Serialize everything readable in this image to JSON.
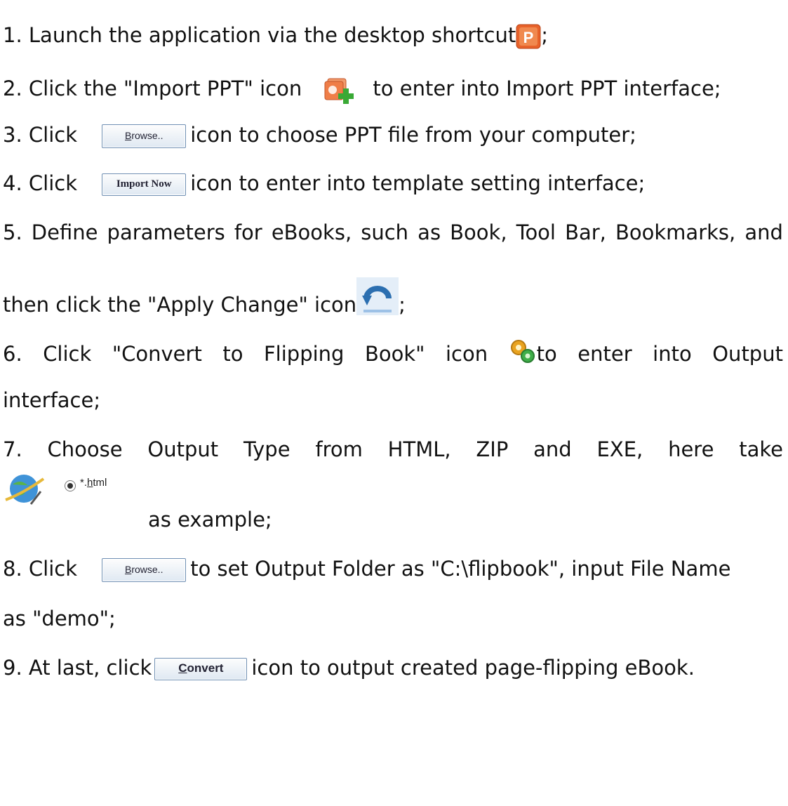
{
  "steps": {
    "s1": {
      "text": "1. Launch the application via the desktop shortcut",
      "after": ";",
      "icon": "powerpoint-shortcut-icon"
    },
    "s2": {
      "text": "2. Click the \"Import PPT\" icon",
      "after": "to enter into Import PPT interface;",
      "icon": "import-ppt-icon"
    },
    "s3": {
      "text": "3. Click",
      "button": "Browse..",
      "after": "icon to choose PPT file from your computer;"
    },
    "s4": {
      "text": "4. Click",
      "button": "Import Now",
      "after": "icon to enter into template setting interface;"
    },
    "s5": {
      "line1": [
        "5.",
        "Define",
        "parameters",
        "for",
        "eBooks,",
        "such",
        "as",
        "Book,",
        "Tool",
        "Bar,",
        "Bookmarks,",
        "and"
      ],
      "line2": "then click the \"Apply Change\" icon",
      "after": ";",
      "icon": "apply-change-icon"
    },
    "s6": {
      "line1": [
        "6.",
        "Click",
        "\"Convert",
        "to",
        "Flipping",
        "Book\"",
        "icon"
      ],
      "after_words": [
        "to",
        "enter",
        "into",
        "Output"
      ],
      "line2": "interface;",
      "icon": "gears-icon"
    },
    "s7": {
      "line1": [
        "7.",
        "Choose",
        "Output",
        "Type",
        "from",
        "HTML,",
        "ZIP",
        "and",
        "EXE,",
        "here",
        "take"
      ],
      "radio_label": "*.html",
      "line2": "as example;",
      "icon": "globe-html-icon"
    },
    "s8": {
      "text": "8. Click",
      "button": "Browse..",
      "after": "to set Output Folder as \"C:\\flipbook\", input File Name",
      "line2": "as \"demo\";"
    },
    "s9": {
      "text": "9. At last, click",
      "button": "Convert",
      "after": "icon to output created page-flipping eBook."
    }
  },
  "colors": {
    "text": "#111111",
    "button_border": "#6f8fb3",
    "ppt_orange": "#e8622a",
    "plus_green": "#39a935",
    "apply_blue": "#2c6fb0"
  }
}
